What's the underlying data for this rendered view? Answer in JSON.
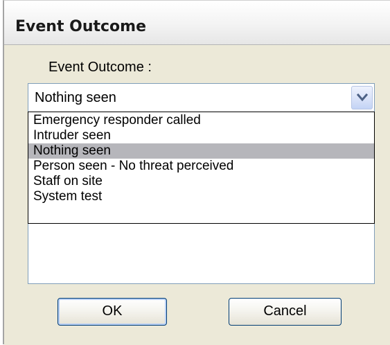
{
  "dialog": {
    "title": "Event Outcome"
  },
  "field": {
    "label": "Event Outcome :",
    "selected_value": "Nothing seen",
    "options": [
      "Emergency responder called",
      "Intruder seen",
      "Nothing seen",
      "Person seen - No threat perceived",
      "Staff on site",
      "System test"
    ],
    "selected_index": 2
  },
  "buttons": {
    "ok_label": "OK",
    "cancel_label": "Cancel"
  },
  "icons": {
    "dropdown": "chevron-down-icon"
  },
  "colors": {
    "dialog_background": "#ece9d8",
    "selection_highlight": "#b6b6bb",
    "field_border": "#7f9db9",
    "button_border": "#003c74"
  }
}
